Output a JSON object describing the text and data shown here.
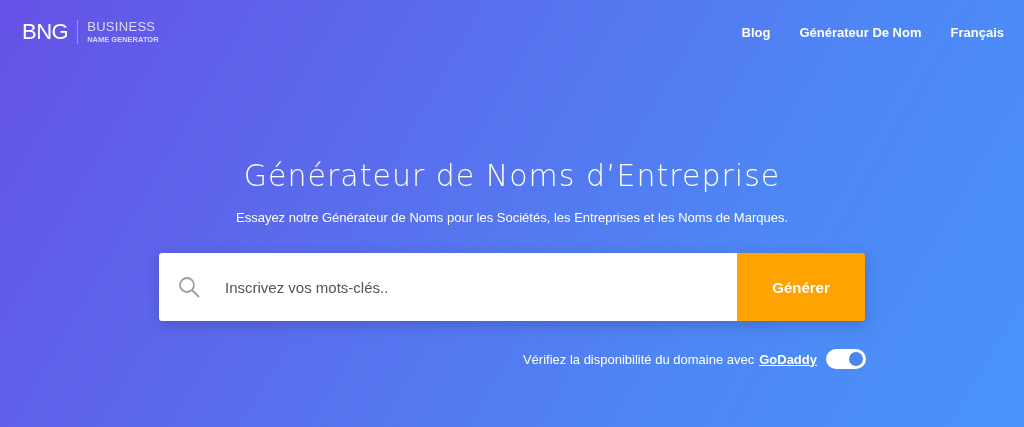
{
  "logo": {
    "mark": "BNG",
    "line_1": "BUSINESS",
    "line_2": "NAME GENERATOR"
  },
  "nav": [
    {
      "label": "Blog"
    },
    {
      "label": "Générateur De Nom"
    },
    {
      "label": "Français"
    }
  ],
  "hero": {
    "title": "Générateur de Noms d’Entreprise",
    "subtitle": "Essayez notre Générateur de Noms pour les Sociétés, les Entreprises et les Noms de Marques."
  },
  "search": {
    "placeholder": "Inscrivez vos mots-clés..",
    "button": "Générer"
  },
  "domain_check": {
    "text": "Vérifiez la disponibilité du domaine avec",
    "link": "GoDaddy",
    "on": true
  }
}
